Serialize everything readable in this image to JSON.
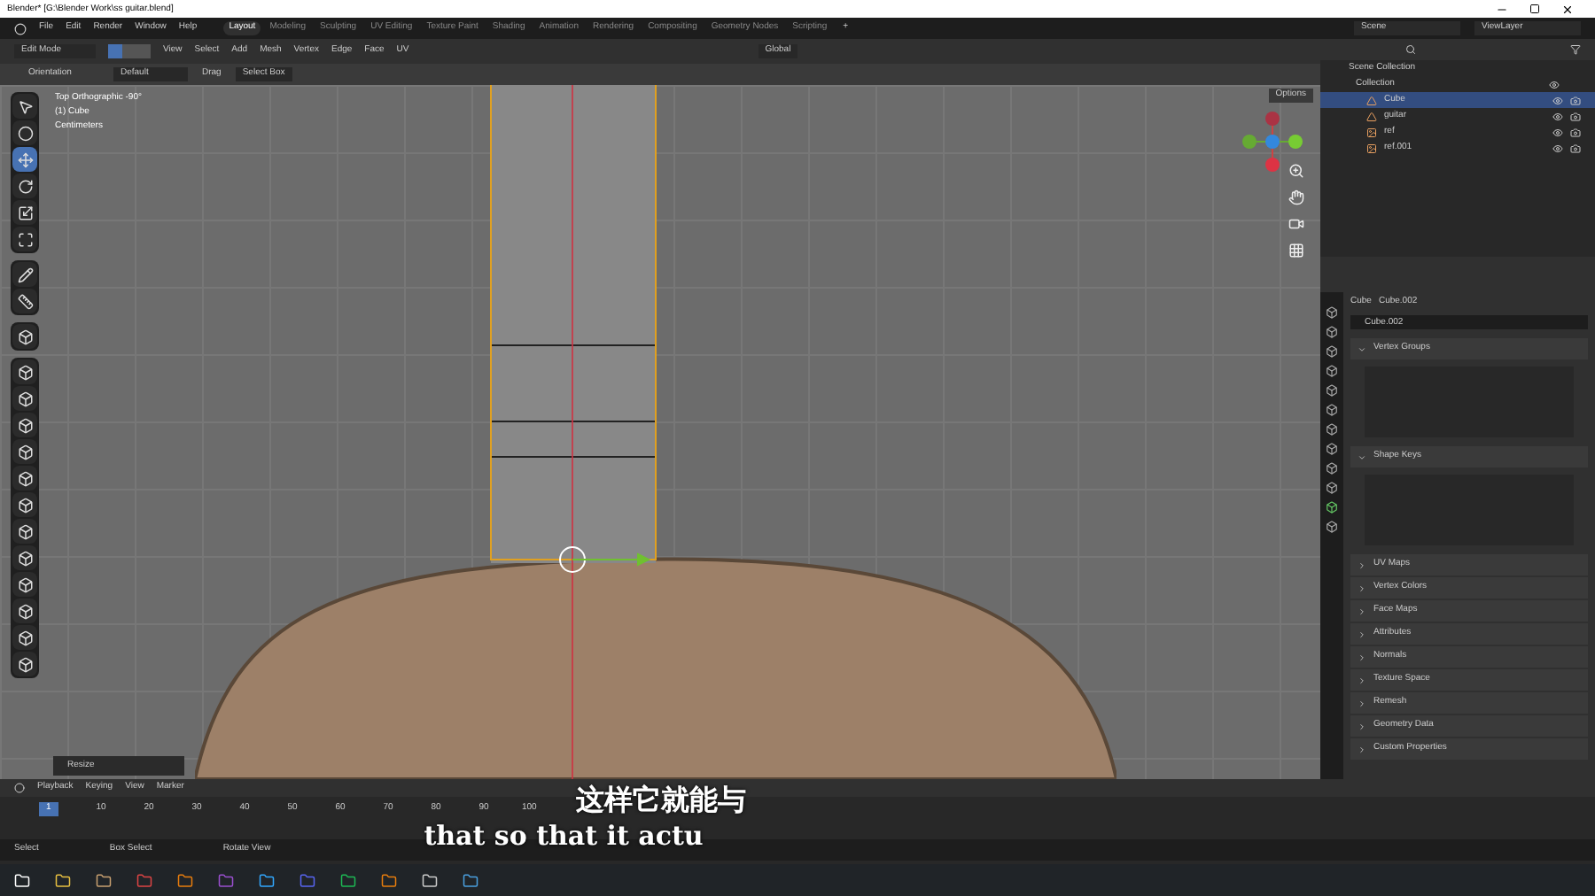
{
  "window": {
    "title": "Blender* [G:\\Blender Work\\ss guitar.blend]"
  },
  "menu": [
    "File",
    "Edit",
    "Render",
    "Window",
    "Help"
  ],
  "workspaces": [
    {
      "label": "Layout",
      "selected": true
    },
    {
      "label": "Modeling",
      "selected": false
    },
    {
      "label": "Sculpting",
      "selected": false
    },
    {
      "label": "UV Editing",
      "selected": false
    },
    {
      "label": "Texture Paint",
      "selected": false
    },
    {
      "label": "Shading",
      "selected": false
    },
    {
      "label": "Animation",
      "selected": false
    },
    {
      "label": "Rendering",
      "selected": false
    },
    {
      "label": "Compositing",
      "selected": false
    },
    {
      "label": "Geometry Nodes",
      "selected": false
    },
    {
      "label": "Scripting",
      "selected": false
    }
  ],
  "add_workspace": "+",
  "scene": "Scene",
  "view_layer": "ViewLayer",
  "header": {
    "mode": "Edit Mode",
    "select_modes": [
      {
        "selected": true
      },
      {
        "selected": false
      },
      {
        "selected": false
      }
    ],
    "menus": [
      "View",
      "Select",
      "Add",
      "Mesh",
      "Vertex",
      "Edge",
      "Face",
      "UV"
    ],
    "orientation": "Global"
  },
  "tool_settings": {
    "orientation_label": "Orientation",
    "orientation": "Default",
    "drag_label": "Drag",
    "drag": "Select Box",
    "options": "Options"
  },
  "viewport": {
    "overlay_text": [
      "Top Orthographic -90°",
      "(1) Cube",
      "Centimeters"
    ],
    "operator_panel": "Resize",
    "toolbar": [
      [
        {
          "selected": false
        },
        {
          "selected": false
        },
        {
          "selected": true
        },
        {
          "selected": false
        },
        {
          "selected": false
        },
        {
          "selected": false
        }
      ],
      [
        {
          "selected": false
        },
        {
          "selected": false
        }
      ],
      [
        {
          "selected": false
        }
      ],
      [
        {
          "selected": false
        },
        {
          "selected": false
        },
        {
          "selected": false
        },
        {
          "selected": false
        },
        {
          "selected": false
        },
        {
          "selected": false
        },
        {
          "selected": false
        },
        {
          "selected": false
        },
        {
          "selected": false
        },
        {
          "selected": false
        },
        {
          "selected": false
        },
        {
          "selected": false
        }
      ]
    ]
  },
  "outliner": {
    "root": "Scene Collection",
    "collection": "Collection",
    "objects": [
      {
        "name": "Cube",
        "kind": "mesh",
        "selected": true
      },
      {
        "name": "guitar",
        "kind": "mesh",
        "selected": false
      },
      {
        "name": "ref",
        "kind": "image",
        "selected": false
      },
      {
        "name": "ref.001",
        "kind": "image",
        "selected": false
      }
    ]
  },
  "properties": {
    "breadcrumb": [
      "Cube",
      "Cube.002"
    ],
    "datablock": "Cube.002",
    "panels": [
      {
        "title": "Vertex Groups",
        "expanded": true
      },
      {
        "title": "Shape Keys",
        "expanded": true
      },
      {
        "title": "UV Maps",
        "expanded": false
      },
      {
        "title": "Vertex Colors",
        "expanded": false
      },
      {
        "title": "Face Maps",
        "expanded": false
      },
      {
        "title": "Attributes",
        "expanded": false
      },
      {
        "title": "Normals",
        "expanded": false
      },
      {
        "title": "Texture Space",
        "expanded": false
      },
      {
        "title": "Remesh",
        "expanded": false
      },
      {
        "title": "Geometry Data",
        "expanded": false
      },
      {
        "title": "Custom Properties",
        "expanded": false
      }
    ]
  },
  "timeline": {
    "menus": [
      "Playback",
      "Keying",
      "View",
      "Marker"
    ],
    "current_frame": "1",
    "ticks": [
      "10",
      "20",
      "30",
      "40",
      "50",
      "60",
      "70",
      "80",
      "90",
      "100"
    ]
  },
  "status_bar": [
    "Select",
    "Box Select",
    "Rotate View"
  ],
  "subtitles": [
    "这样它就能与",
    "that so that it actu"
  ]
}
